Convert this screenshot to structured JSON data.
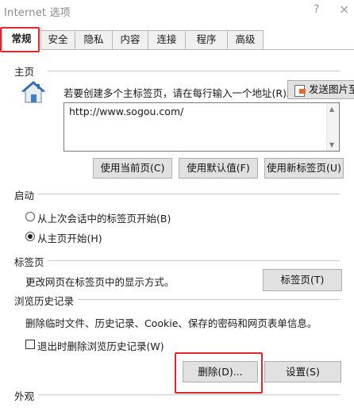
{
  "window": {
    "title": "Internet 选项",
    "help_glyph": "?",
    "close_glyph": "×"
  },
  "tabs": [
    {
      "label": "常规",
      "active": true
    },
    {
      "label": "安全"
    },
    {
      "label": "隐私"
    },
    {
      "label": "内容"
    },
    {
      "label": "连接"
    },
    {
      "label": "程序"
    },
    {
      "label": "高级"
    }
  ],
  "homepage": {
    "section": "主页",
    "hint": "若要创建多个主标签页，请在每行输入一个地址(R)。",
    "send_button": "发送图片至",
    "url": "http://www.sogou.com/",
    "btn_current": "使用当前页(C)",
    "btn_default": "使用默认值(F)",
    "btn_newtab": "使用新标签页(U)"
  },
  "startup": {
    "section": "启动",
    "option1": "从上次会话中的标签页开始(B)",
    "option2": "从主页开始(H)",
    "selected": 2
  },
  "tabs_section": {
    "section": "标签页",
    "description": "更改网页在标签页中的显示方式。",
    "button": "标签页(T)"
  },
  "history": {
    "section": "浏览历史记录",
    "description": "删除临时文件、历史记录、Cookie、保存的密码和网页表单信息。",
    "checkbox_label": "退出时删除浏览历史记录(W)",
    "checked": false,
    "delete_button": "删除(D)...",
    "settings_button": "设置(S)"
  },
  "appearance": {
    "section": "外观"
  },
  "colors": {
    "highlight": "#e0272b",
    "icon_blue": "#2f6fb5"
  }
}
